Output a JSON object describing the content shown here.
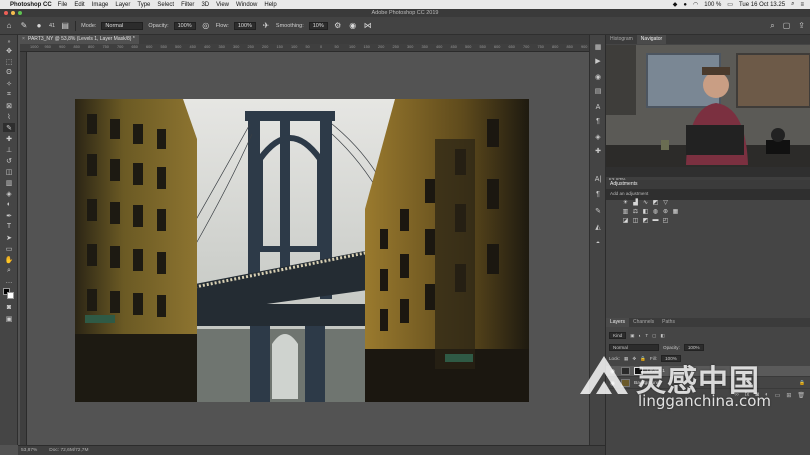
{
  "menubar": {
    "app_name": "Photoshop CC",
    "items": [
      "File",
      "Edit",
      "Image",
      "Layer",
      "Type",
      "Select",
      "Filter",
      "3D",
      "View",
      "Window",
      "Help"
    ],
    "battery": "100 %",
    "clock": "Tue 16 Oct  13.25"
  },
  "window": {
    "title": "Adobe Photoshop CC 2019"
  },
  "options": {
    "brush_size": "41",
    "mode_label": "Mode:",
    "mode_value": "Normal",
    "opacity_label": "Opacity:",
    "opacity_value": "100%",
    "flow_label": "Flow:",
    "flow_value": "100%",
    "smoothing_label": "Smoothing:",
    "smoothing_value": "10%"
  },
  "document": {
    "tab_title": "PART3_NY @ 53,8% (Levels 1, Layer Mask/8) *"
  },
  "ruler": {
    "top_ticks": [
      "1000",
      "950",
      "900",
      "850",
      "800",
      "750",
      "700",
      "650",
      "600",
      "550",
      "500",
      "450",
      "400",
      "350",
      "300",
      "250",
      "200",
      "150",
      "100",
      "50",
      "0",
      "50",
      "100",
      "150",
      "200",
      "250",
      "300",
      "350",
      "400",
      "450",
      "500",
      "550",
      "600",
      "650",
      "700",
      "750",
      "800",
      "850",
      "900",
      "950"
    ]
  },
  "status": {
    "zoom": "53,87%",
    "doc_size": "Doc: 72,6M/72,7M"
  },
  "panels": {
    "top_tabs": [
      "Histogram",
      "Navigator"
    ],
    "navigator_zoom": "53,87%",
    "adjustments_title": "Adjustments",
    "adjustments_sub": "Add an adjustment",
    "layers_tabs": [
      "Layers",
      "Channels",
      "Paths"
    ],
    "kind_label": "Kind",
    "blend_mode": "Normal",
    "opacity_label": "Opacity:",
    "opacity_value": "100%",
    "lock_label": "Lock:",
    "fill_label": "Fill:",
    "fill_value": "100%",
    "layers": [
      {
        "name": "Levels 1",
        "selected": true
      },
      {
        "name": "Background",
        "selected": false
      }
    ]
  },
  "watermark": {
    "chinese": "灵感中国",
    "latin": "lingganchina.com"
  },
  "colors": {
    "accent": "#2d8ceb",
    "panel": "#454545",
    "canvas": "#535353"
  }
}
